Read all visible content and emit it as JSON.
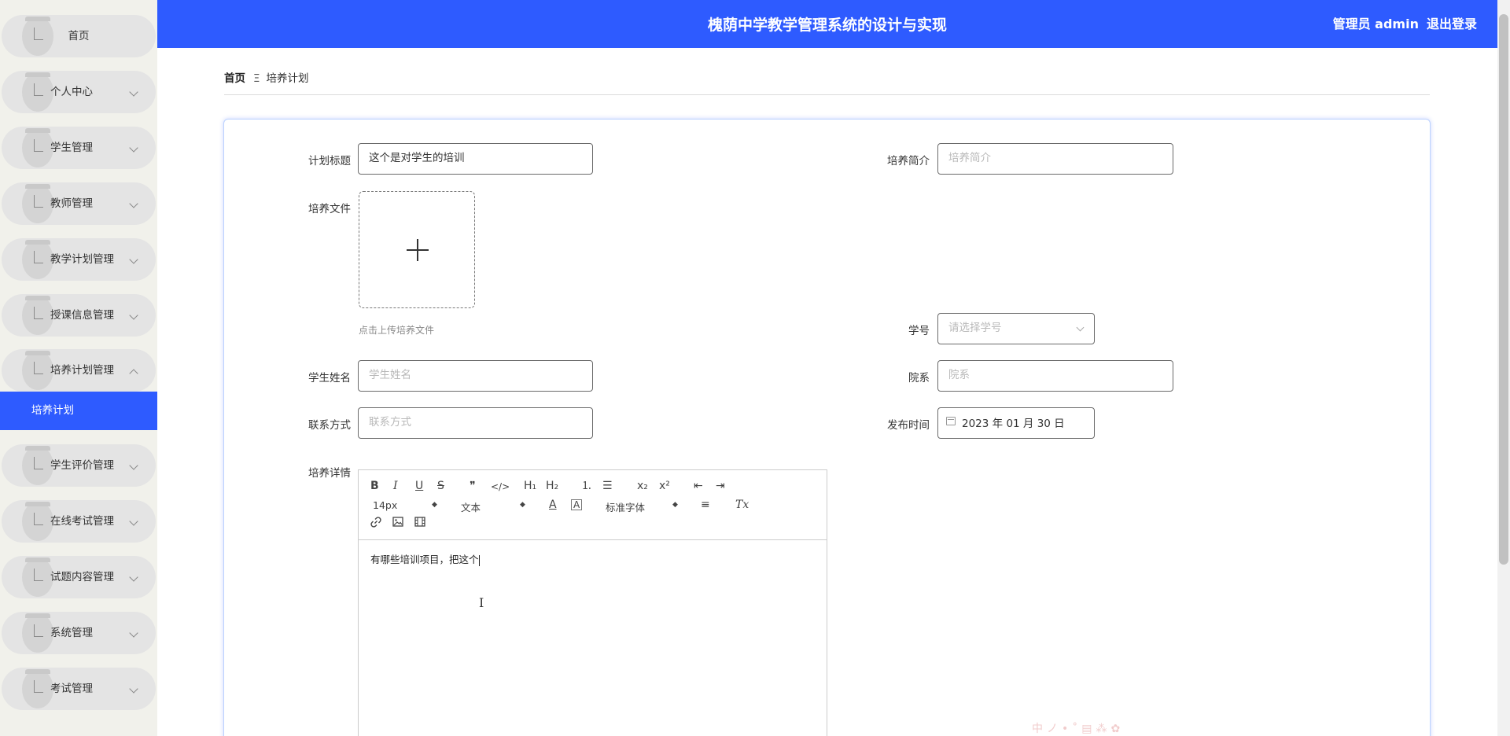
{
  "header": {
    "title": "槐荫中学教学管理系统的设计与实现",
    "user_label": "管理员 admin",
    "logout_label": "退出登录"
  },
  "sidebar": {
    "items": [
      {
        "label": "首页"
      },
      {
        "label": "个人中心"
      },
      {
        "label": "学生管理"
      },
      {
        "label": "教师管理"
      },
      {
        "label": "教学计划管理"
      },
      {
        "label": "授课信息管理"
      },
      {
        "label": "培养计划管理"
      },
      {
        "label": "学生评价管理"
      },
      {
        "label": "在线考试管理"
      },
      {
        "label": "试题内容管理"
      },
      {
        "label": "系统管理"
      },
      {
        "label": "考试管理"
      }
    ],
    "active_sub": "培养计划"
  },
  "breadcrumb": {
    "home": "首页",
    "separator": "Ξ",
    "current": "培养计划"
  },
  "form": {
    "title_label": "计划标题",
    "title_value": "这个是对学生的培训",
    "intro_label": "培养简介",
    "intro_placeholder": "培养简介",
    "file_label": "培养文件",
    "upload_hint": "点击上传培养文件",
    "student_no_label": "学号",
    "student_no_placeholder": "请选择学号",
    "student_name_label": "学生姓名",
    "student_name_placeholder": "学生姓名",
    "department_label": "院系",
    "department_placeholder": "院系",
    "contact_label": "联系方式",
    "contact_placeholder": "联系方式",
    "publish_time_label": "发布时间",
    "publish_time_value": "2023 年 01 月 30 日",
    "detail_label": "培养详情"
  },
  "editor": {
    "toolbar": {
      "bold": "B",
      "italic": "I",
      "underline": "U",
      "strike": "S",
      "blockquote": "❞",
      "code": "</>",
      "h1": "H₁",
      "h2": "H₂",
      "ordered_list": "⒈",
      "bullet_list": "☰",
      "subscript": "x₂",
      "superscript": "x²",
      "outdent": "⇤",
      "indent": "⇥",
      "font_size": "14px",
      "header_select": "文本",
      "font_family": "标准字体",
      "text_color": "A",
      "background_color": "A",
      "align": "≡",
      "clean": "Tx"
    },
    "content": "有哪些培训项目，把这个"
  },
  "watermark": "中ノ•˚▤⁂✿"
}
